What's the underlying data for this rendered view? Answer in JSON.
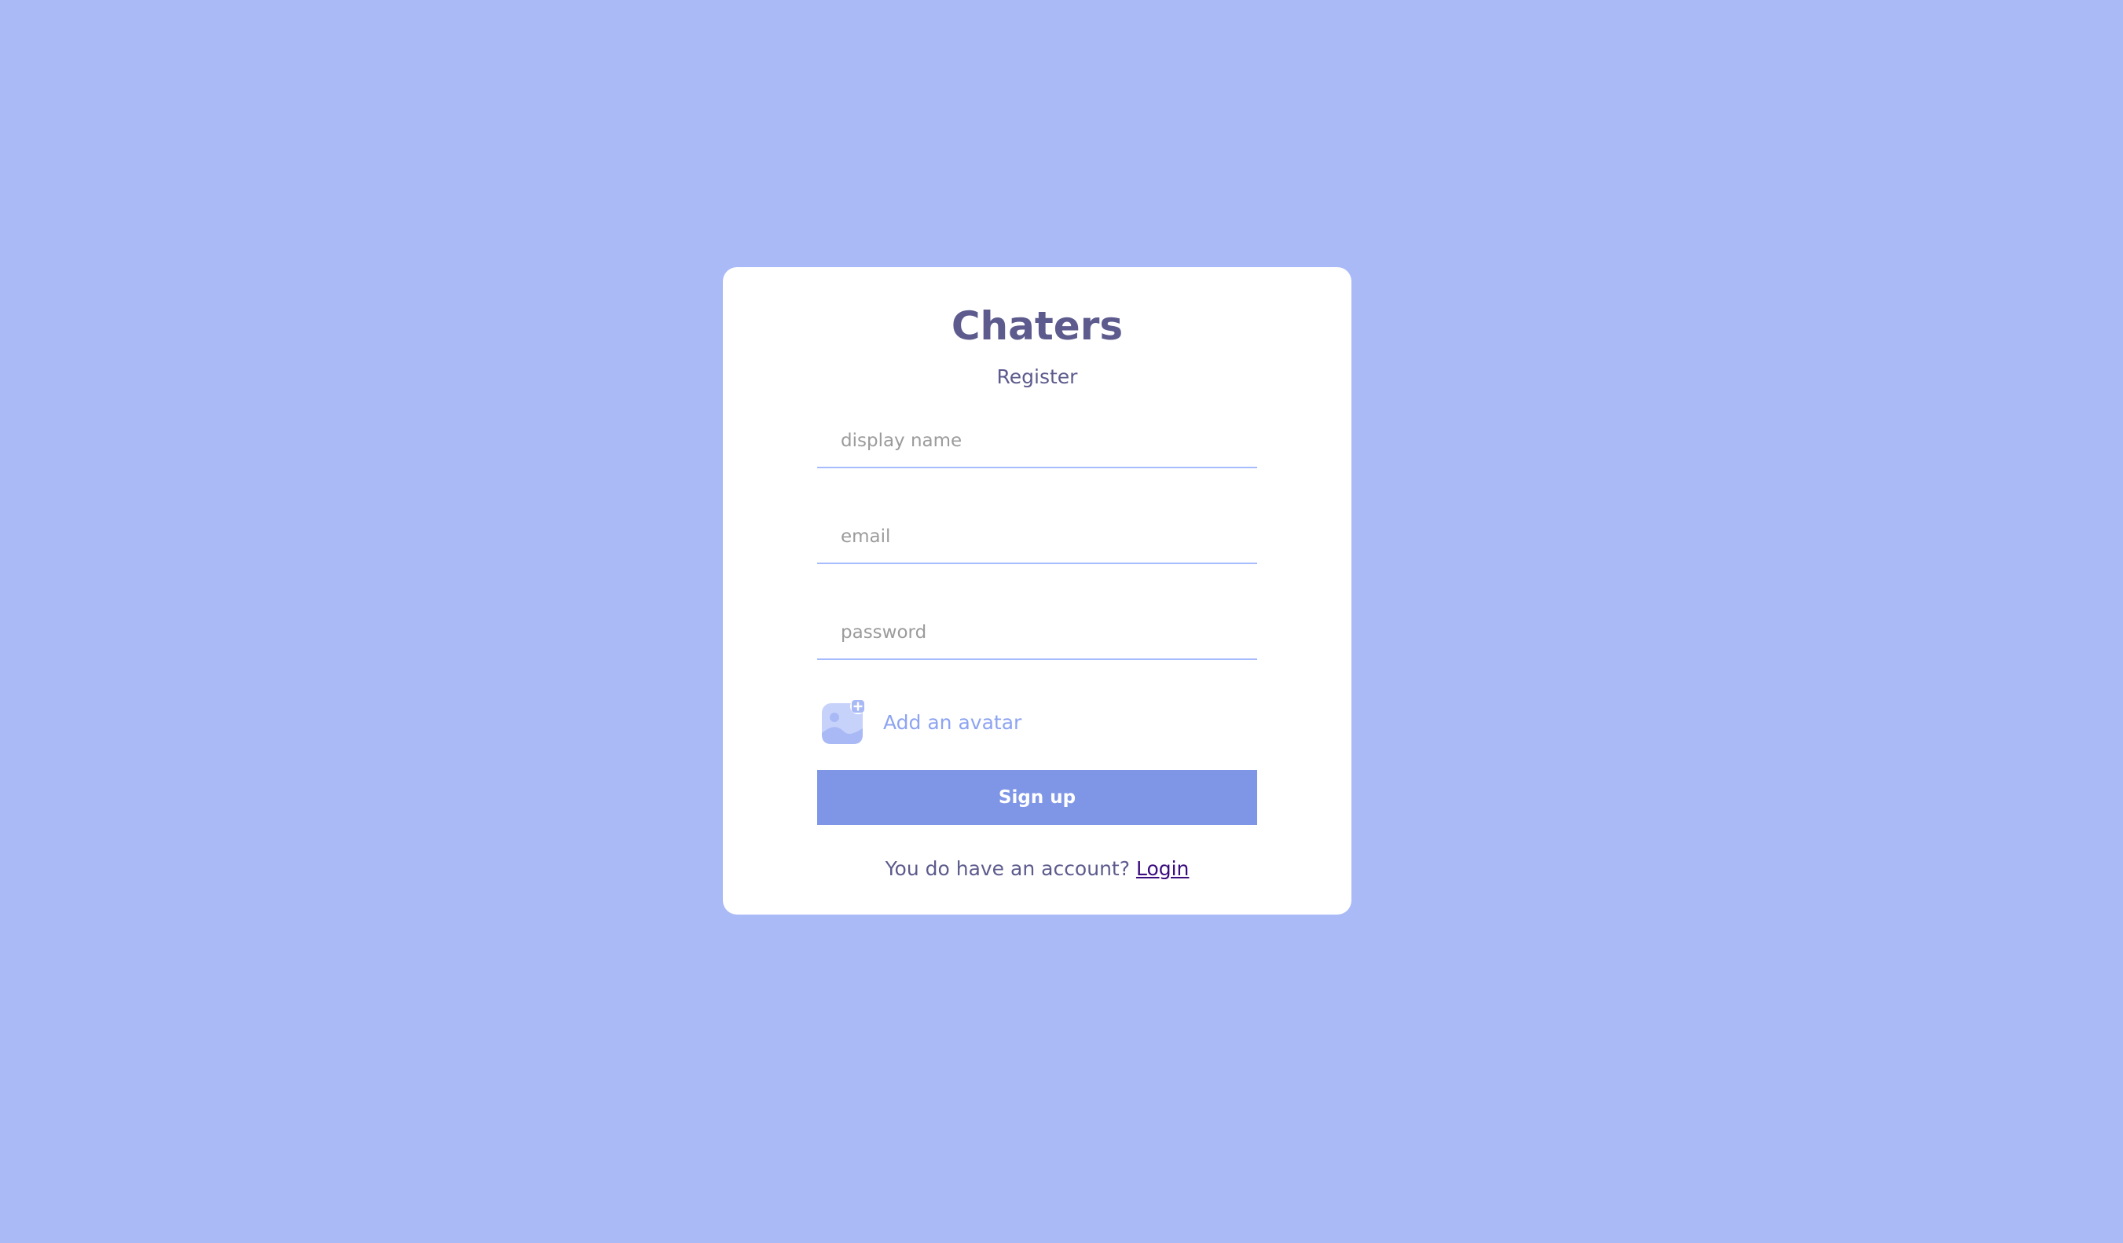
{
  "app": {
    "logo": "Chaters",
    "subtitle": "Register"
  },
  "form": {
    "display_name": {
      "placeholder": "display name",
      "value": ""
    },
    "email": {
      "placeholder": "email",
      "value": ""
    },
    "password": {
      "placeholder": "password",
      "value": ""
    },
    "avatar_label": "Add an avatar",
    "avatar_icon": "add-image-icon",
    "submit_label": "Sign up"
  },
  "footer": {
    "prompt": "You do have an account? ",
    "link_label": "Login"
  },
  "colors": {
    "background": "#aabaf7",
    "card": "#ffffff",
    "text": "#5d5b8d",
    "accent": "#7f96e6",
    "field_border": "#a7bcff",
    "link": "#3b0c7e"
  }
}
